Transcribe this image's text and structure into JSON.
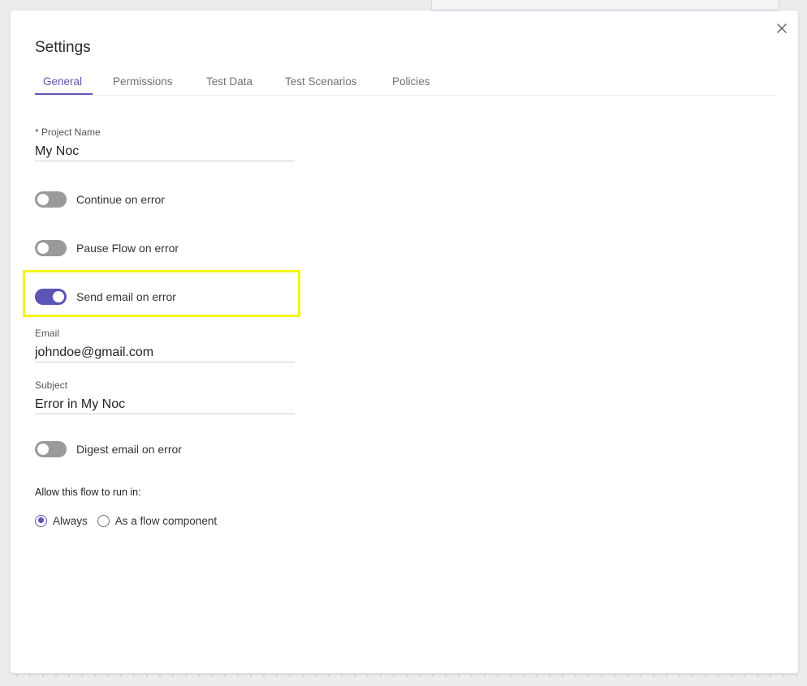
{
  "dialog": {
    "title": "Settings",
    "close_icon": "close-icon"
  },
  "tabs": [
    {
      "label": "General",
      "active": true
    },
    {
      "label": "Permissions",
      "active": false
    },
    {
      "label": "Test Data",
      "active": false
    },
    {
      "label": "Test Scenarios",
      "active": false
    },
    {
      "label": "Policies",
      "active": false
    }
  ],
  "general": {
    "project_name": {
      "label": "* Project Name",
      "value": "My Noc"
    },
    "continue_on_error": {
      "label": "Continue on error",
      "on": false
    },
    "pause_flow_on_error": {
      "label": "Pause Flow on error",
      "on": false
    },
    "send_email_on_error": {
      "label": "Send email on error",
      "on": true
    },
    "email": {
      "label": "Email",
      "value": "johndoe@gmail.com"
    },
    "subject": {
      "label": "Subject",
      "value": "Error in My Noc"
    },
    "digest_email_on_error": {
      "label": "Digest email on error",
      "on": false
    },
    "run_in": {
      "label": "Allow this flow to run in:",
      "options": [
        {
          "label": "Always",
          "checked": true
        },
        {
          "label": "As a flow component",
          "checked": false
        }
      ]
    }
  },
  "colors": {
    "accent": "#5b55b5",
    "toggle_off": "#9a9a9a",
    "highlight": "#f4f41a"
  }
}
